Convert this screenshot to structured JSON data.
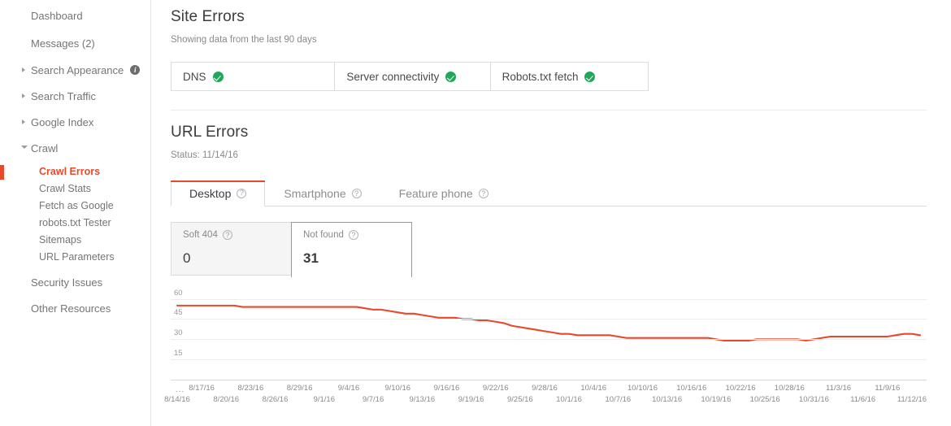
{
  "sidebar": {
    "items": [
      {
        "label": "Dashboard",
        "type": "top",
        "expandable": false
      },
      {
        "label": "Messages (2)",
        "type": "top",
        "expandable": false
      },
      {
        "label": "Search Appearance",
        "type": "group",
        "expandable": true,
        "expanded": false,
        "info_icon": "info-icon"
      },
      {
        "label": "Search Traffic",
        "type": "group",
        "expandable": true,
        "expanded": false
      },
      {
        "label": "Google Index",
        "type": "group",
        "expandable": true,
        "expanded": false
      },
      {
        "label": "Crawl",
        "type": "group",
        "expandable": true,
        "expanded": true
      },
      {
        "label": "Crawl Errors",
        "type": "child",
        "active": true
      },
      {
        "label": "Crawl Stats",
        "type": "child",
        "active": false
      },
      {
        "label": "Fetch as Google",
        "type": "child",
        "active": false
      },
      {
        "label": "robots.txt Tester",
        "type": "child",
        "active": false
      },
      {
        "label": "Sitemaps",
        "type": "child",
        "active": false
      },
      {
        "label": "URL Parameters",
        "type": "child",
        "active": false
      },
      {
        "label": "Security Issues",
        "type": "top2",
        "expandable": false
      },
      {
        "label": "Other Resources",
        "type": "top2",
        "expandable": false
      }
    ]
  },
  "site_errors": {
    "title": "Site Errors",
    "subtitle": "Showing data from the last 90 days",
    "cells": [
      {
        "label": "DNS",
        "status_icon": "check-circle-icon",
        "status": "ok"
      },
      {
        "label": "Server connectivity",
        "status_icon": "check-circle-icon",
        "status": "ok"
      },
      {
        "label": "Robots.txt fetch",
        "status_icon": "check-circle-icon",
        "status": "ok"
      }
    ]
  },
  "url_errors": {
    "title": "URL Errors",
    "status_line": "Status: 11/14/16",
    "tabs": [
      {
        "label": "Desktop",
        "help_icon": "help-icon",
        "active": true
      },
      {
        "label": "Smartphone",
        "help_icon": "help-icon",
        "active": false
      },
      {
        "label": "Feature phone",
        "help_icon": "help-icon",
        "active": false
      }
    ],
    "metrics": [
      {
        "label": "Soft 404",
        "help_icon": "help-icon",
        "value": "0",
        "selected": false
      },
      {
        "label": "Not found",
        "help_icon": "help-icon",
        "value": "31",
        "selected": true
      }
    ]
  },
  "colors": {
    "accent": "#e8492b",
    "ok_green": "#20a85a",
    "text_dark": "#3c3c3c",
    "text_muted": "#8a8a8a"
  },
  "chart_data": {
    "type": "line",
    "title": "",
    "xlabel": "",
    "ylabel": "",
    "ylim": [
      0,
      67
    ],
    "yticks": [
      15,
      30,
      45,
      60
    ],
    "grid": true,
    "legend": false,
    "line_color": "#e8492b",
    "leading_ellipsis": "...",
    "x_labels_row1": [
      "8/17/16",
      "8/23/16",
      "8/29/16",
      "9/4/16",
      "9/10/16",
      "9/16/16",
      "9/22/16",
      "9/28/16",
      "10/4/16",
      "10/10/16",
      "10/16/16",
      "10/22/16",
      "10/28/16",
      "11/3/16",
      "11/9/16"
    ],
    "x_labels_row2": [
      "8/14/16",
      "8/20/16",
      "8/26/16",
      "9/1/16",
      "9/7/16",
      "9/13/16",
      "9/19/16",
      "9/25/16",
      "10/1/16",
      "10/7/16",
      "10/13/16",
      "10/19/16",
      "10/25/16",
      "10/31/16",
      "11/6/16",
      "11/12/16"
    ],
    "x": [
      "8/14/16",
      "8/15/16",
      "8/16/16",
      "8/17/16",
      "8/18/16",
      "8/19/16",
      "8/20/16",
      "8/21/16",
      "8/22/16",
      "8/23/16",
      "8/24/16",
      "8/25/16",
      "8/26/16",
      "8/27/16",
      "8/28/16",
      "8/29/16",
      "8/30/16",
      "8/31/16",
      "9/1/16",
      "9/2/16",
      "9/3/16",
      "9/4/16",
      "9/5/16",
      "9/6/16",
      "9/7/16",
      "9/8/16",
      "9/9/16",
      "9/10/16",
      "9/11/16",
      "9/12/16",
      "9/13/16",
      "9/14/16",
      "9/15/16",
      "9/16/16",
      "9/17/16",
      "9/18/16",
      "9/19/16",
      "9/20/16",
      "9/21/16",
      "9/22/16",
      "9/23/16",
      "9/24/16",
      "9/25/16",
      "9/26/16",
      "9/27/16",
      "9/28/16",
      "9/29/16",
      "9/30/16",
      "10/1/16",
      "10/2/16",
      "10/3/16",
      "10/4/16",
      "10/5/16",
      "10/6/16",
      "10/7/16",
      "10/8/16",
      "10/9/16",
      "10/10/16",
      "10/11/16",
      "10/12/16",
      "10/13/16",
      "10/14/16",
      "10/15/16",
      "10/16/16",
      "10/17/16",
      "10/18/16",
      "10/19/16",
      "10/20/16",
      "10/21/16",
      "10/22/16",
      "10/23/16",
      "10/24/16",
      "10/25/16",
      "10/26/16",
      "10/27/16",
      "10/28/16",
      "10/29/16",
      "10/30/16",
      "10/31/16",
      "11/1/16",
      "11/2/16",
      "11/3/16",
      "11/4/16",
      "11/5/16",
      "11/6/16",
      "11/7/16",
      "11/8/16",
      "11/9/16",
      "11/10/16",
      "11/11/16",
      "11/12/16"
    ],
    "series": [
      {
        "name": "Not found",
        "values": [
          55,
          55,
          55,
          55,
          55,
          55,
          55,
          55,
          54,
          54,
          54,
          54,
          54,
          54,
          54,
          54,
          54,
          54,
          54,
          54,
          54,
          54,
          54,
          53,
          52,
          52,
          51,
          50,
          49,
          49,
          48,
          47,
          46,
          46,
          46,
          45,
          45,
          44,
          44,
          43,
          42,
          40,
          39,
          38,
          37,
          36,
          35,
          34,
          34,
          33,
          33,
          33,
          33,
          33,
          32,
          31,
          31,
          31,
          31,
          31,
          31,
          31,
          31,
          31,
          31,
          31,
          30,
          29,
          29,
          29,
          29,
          30,
          30,
          30,
          30,
          30,
          30,
          29,
          30,
          31,
          32,
          32,
          32,
          32,
          32,
          32,
          32,
          32,
          33,
          34,
          34,
          33
        ]
      }
    ]
  }
}
